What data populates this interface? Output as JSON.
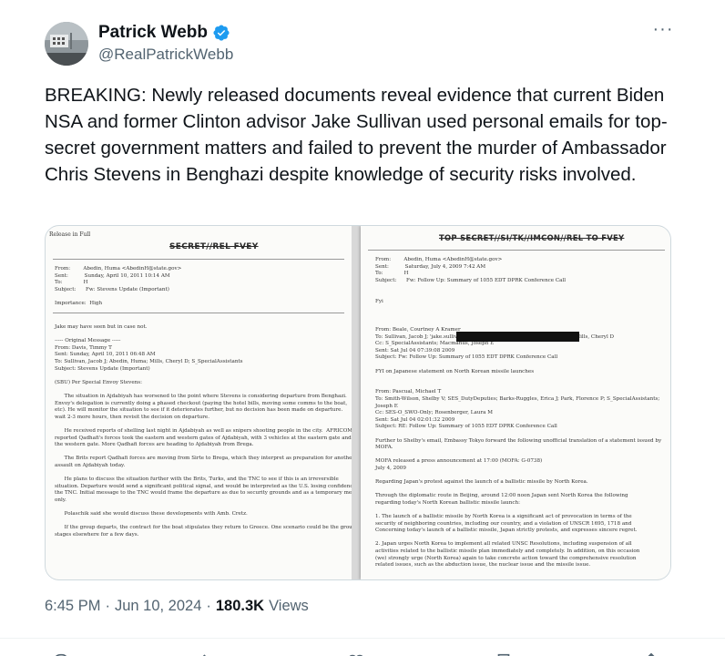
{
  "author": {
    "display_name": "Patrick Webb",
    "handle": "@RealPatrickWebb",
    "verified": true,
    "verified_color": "#1d9bf0"
  },
  "more_menu": {
    "icon": "more-dots-icon",
    "glyph": "···"
  },
  "tweet": {
    "text": "BREAKING: Newly released documents reveal evidence that current Biden NSA and former Clinton advisor Jake Sullivan used personal emails for top-secret government matters and failed to prevent the murder of Ambassador Chris Stevens in Benghazi despite knowledge of security risks involved."
  },
  "media": {
    "left_doc": {
      "release": "Release in Full",
      "classification": "SECRET//REL FVEY",
      "header": "From:        Abedin, Huma <AbedinH@state.gov>\nSent:          Sunday, April 10, 2011 10:14 AM\nTo:             H\nSubject:      Fw: Stevens Update (Important)\n\nImportance:  High",
      "body": "Jake may have seen but in case not.\n\n----- Original Message -----\nFrom: Davis, Timmy T\nSent: Sunday, April 10, 2011 06:48 AM\nTo: Sullivan, Jacob J; Abedin, Huma; Mills, Cheryl D; S_SpecialAssistants\nSubject: Stevens Update (Important)\n\n(SBU) Per Special Envoy Stevens:\n\n      The situation in Ajdabiyah has worsened to the point where Stevens is considering departure from Benghazi.\nEnvoy's delegation is currently doing a phased checkout (paying the hotel bills, moving some comms to the boat,\netc). He will monitor the situation to see if it deteriorates further, but no decision has been made on departure.\nwait 2-3 more hours, then revisit the decision on departure.\n\n      He received reports of shelling last night in Ajdabiyah as well as snipers shooting people in the city.  AFRICOM\nreported Qadhafi's forces took the eastern and western gates of Ajdabiyah, with 3 vehicles at the eastern gate and\nthe western gate. More Qadhafi forces are heading to Ajdabiyah from Brega.\n\n      The Brits report Qadhafi forces are moving from Sirte to Brega, which they interpret as preparation for another\nassault on Ajdabiyah today.\n\n      He plans to discuss the situation further with the Brits, Turks, and the TNC to see if this is an irreversible\nsituation. Departure would send a significant political signal, and would be interpreted as the U.S. losing confidence in\nthe TNC. Initial message to the TNC would frame the departure as due to security grounds and as a temporary measure\nonly.\n\n      Polaschik said she would discuss these developments with Amb. Cretz.\n\n      If the group departs, the contract for the boat stipulates they return to Greece. One scenario could be the group\nstages elsewhere for a few days."
    },
    "right_doc": {
      "classification": "TOP SECRET//SI/TK//IMCON//REL TO FVEY",
      "header": "From:        Abedin, Huma <AbedinH@state.gov>\nSent:          Saturday, July 4, 2009 7:42 AM\nTo:             H\nSubject:      Fw: Follow Up: Summary of 1055 EDT DPRK Conference Call\n\n\nFyi",
      "body": "From: Beale, Courtney A Kramer\nTo: Sullivan, Jacob J; 'jake.sullivan                                            Abedin, Huma; Mills, Cheryl D\nCc: S_SpecialAssistants; Macmanus, Joseph E\nSent: Sat Jul 04 07:39:08 2009\nSubject: Fw: Follow Up: Summary of 1055 EDT DPRK Conference Call\n\nFYI on Japanese statement on North Korean missile launches\n\n\nFrom: Pascual, Michael T\nTo: Smith-Wilson, Shelby V; SES_DutyDeputies; Barks-Ruggles, Erica J; Park, Florence P; S_SpecialAssistants;\nJoseph E\nCc: SES-O_SWO-Only; Rosenberger, Laura M\nSent: Sat Jul 04 02:01:32 2009\nSubject: RE: Follow Up: Summary of 1055 EDT DPRK Conference Call\n\nFurther to Shelby's email, Embassy Tokyo forward the following unofficial translation of a statement issued by\nMOFA.\n\nMOFA released a press announcement at 17:00 (MOFA: G-0738)\nJuly 4, 2009\n\nRegarding Japan's protest against the launch of a ballistic missile by North Korea.\n\nThrough the diplomatic route in Beijing, around 12:00 noon Japan sent North Korea the following\nregarding today's North Korean ballistic missile launch:\n\n1. The launch of a ballistic missile by North Korea is a significant act of provocation in terms of the\nsecurity of neighboring countries, including our country, and a violation of UNSCR 1695, 1718 and\nConcerning today's launch of a ballistic missile, Japan strictly protests, and expresses sincere regret.\n\n2. Japan urges North Korea to implement all related UNSC Resolutions, including suspension of all\nactivities related to the ballistic missile plan immediately and completely. In addition, on this occasion\n(we) strongly urge (North Korea) again to take concrete action toward the comprehensive resolution\nrelated issues, such as the abduction issue, the nuclear issue and the missile issue."
    }
  },
  "meta": {
    "time": "6:45 PM",
    "separator": "·",
    "date": "Jun 10, 2024",
    "views_count": "180.3K",
    "views_label": "Views"
  }
}
